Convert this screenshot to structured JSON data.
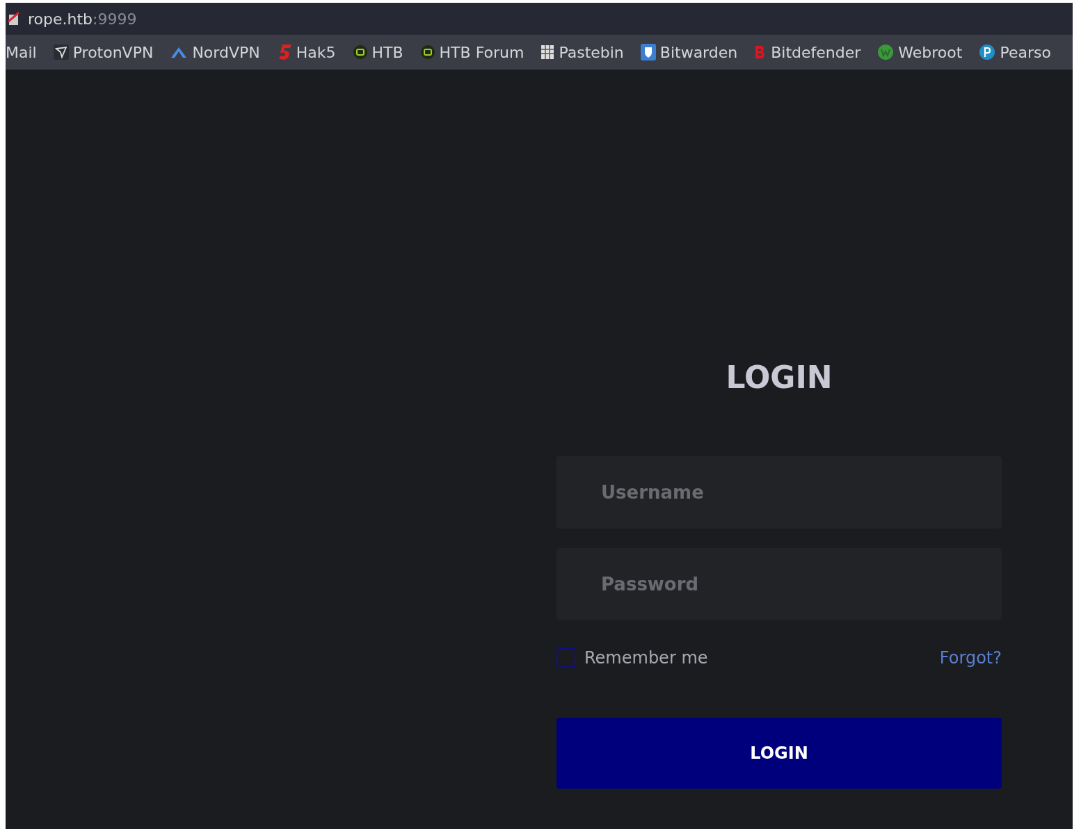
{
  "address_bar": {
    "host": "rope.htb",
    "port": ":9999"
  },
  "bookmarks": [
    {
      "label": "Mail",
      "kind": "none"
    },
    {
      "label": "ProtonVPN",
      "kind": "proton"
    },
    {
      "label": "NordVPN",
      "kind": "nord"
    },
    {
      "label": "Hak5",
      "kind": "hak5"
    },
    {
      "label": "HTB",
      "kind": "htb"
    },
    {
      "label": "HTB Forum",
      "kind": "htb"
    },
    {
      "label": "Pastebin",
      "kind": "pastebin"
    },
    {
      "label": "Bitwarden",
      "kind": "bitwarden"
    },
    {
      "label": "Bitdefender",
      "kind": "bitdefender"
    },
    {
      "label": "Webroot",
      "kind": "webroot"
    },
    {
      "label": "Pearso",
      "kind": "pearson"
    }
  ],
  "login": {
    "title": "LOGIN",
    "username": {
      "placeholder": "Username"
    },
    "password": {
      "placeholder": "Password"
    },
    "remember": {
      "label": "Remember me",
      "checked": false
    },
    "forgot": "Forgot?",
    "button": "LOGIN"
  }
}
